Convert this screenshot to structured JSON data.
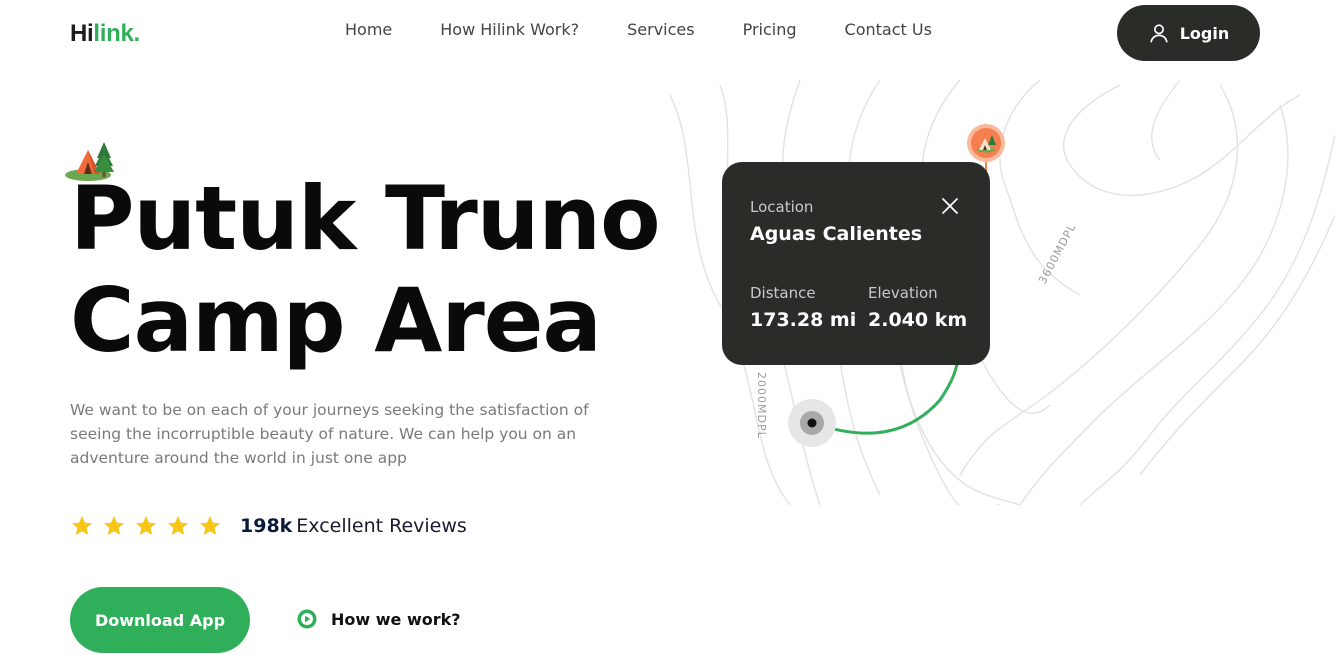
{
  "brand": {
    "logo_prefix": "Hi",
    "logo_suffix": "link."
  },
  "nav": {
    "items": [
      "Home",
      "How Hilink Work?",
      "Services",
      "Pricing",
      "Contact Us"
    ]
  },
  "header": {
    "login_label": "Login"
  },
  "hero": {
    "title_line1": "Putuk Truno",
    "title_line2": "Camp Area",
    "description": "We want to be on each of your journeys seeking the satisfaction of seeing the incorruptible beauty of nature. We can help you on an adventure around the world in just one app",
    "rating_stars": 5,
    "reviews_count": "198k",
    "reviews_label": "Excellent Reviews",
    "download_label": "Download App",
    "how_label": "How we work?"
  },
  "map": {
    "altitude_labels": [
      "3600MDPL",
      "2000MDPL"
    ],
    "card": {
      "location_label": "Location",
      "location_value": "Aguas Calientes",
      "distance_label": "Distance",
      "distance_value": "173.28 mi",
      "elevation_label": "Elevation",
      "elevation_value": "2.040 km"
    }
  },
  "colors": {
    "brand_green": "#30af5b",
    "dark": "#292c27",
    "star": "#f5c518",
    "pin_orange": "#f57f4f"
  },
  "icons": {
    "login": "user-icon",
    "camp": "camp-tent-icon",
    "close": "close-icon",
    "play": "play-icon",
    "star": "star-icon",
    "pin": "map-pin-icon"
  }
}
